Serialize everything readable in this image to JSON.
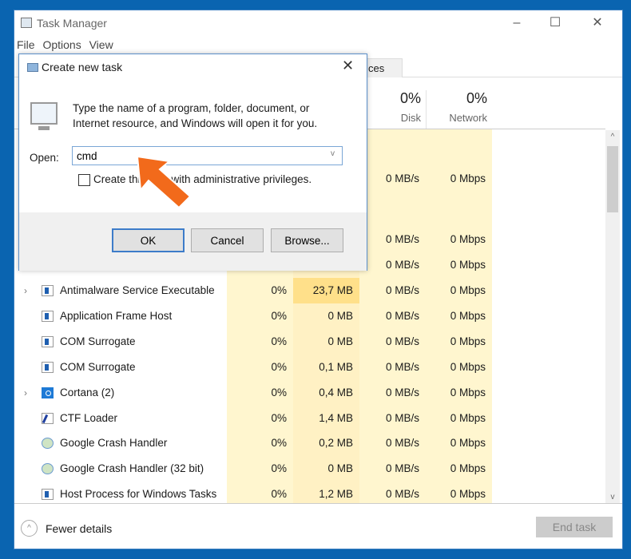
{
  "window": {
    "title": "Task Manager",
    "minimize": "–",
    "maximize": "☐",
    "close": "✕"
  },
  "menu": [
    "File",
    "Options",
    "View"
  ],
  "tab_partial": "ces",
  "headers": {
    "disk_pct": "0%",
    "disk": "Disk",
    "network_pct": "0%",
    "network": "Network"
  },
  "hidden_rows": [
    {
      "disk": "0 MB/s",
      "network": "0 Mbps"
    },
    {
      "disk": "0 MB/s",
      "network": "0 Mbps"
    },
    {
      "disk": "0 MB/s",
      "network": "0 Mbps"
    }
  ],
  "rows": [
    {
      "name": "Antimalware Service Executable",
      "expandable": true,
      "icon": "app",
      "cpu": "0%",
      "memory": "23,7 MB",
      "disk": "0 MB/s",
      "network": "0 Mbps"
    },
    {
      "name": "Application Frame Host",
      "expandable": false,
      "icon": "app",
      "cpu": "0%",
      "memory": "0 MB",
      "disk": "0 MB/s",
      "network": "0 Mbps"
    },
    {
      "name": "COM Surrogate",
      "expandable": false,
      "icon": "app",
      "cpu": "0%",
      "memory": "0 MB",
      "disk": "0 MB/s",
      "network": "0 Mbps"
    },
    {
      "name": "COM Surrogate",
      "expandable": false,
      "icon": "app",
      "cpu": "0%",
      "memory": "0,1 MB",
      "disk": "0 MB/s",
      "network": "0 Mbps"
    },
    {
      "name": "Cortana (2)",
      "expandable": true,
      "icon": "cortana",
      "cpu": "0%",
      "memory": "0,4 MB",
      "disk": "0 MB/s",
      "network": "0 Mbps"
    },
    {
      "name": "CTF Loader",
      "expandable": false,
      "icon": "ctf",
      "cpu": "0%",
      "memory": "1,4 MB",
      "disk": "0 MB/s",
      "network": "0 Mbps"
    },
    {
      "name": "Google Crash Handler",
      "expandable": false,
      "icon": "google",
      "cpu": "0%",
      "memory": "0,2 MB",
      "disk": "0 MB/s",
      "network": "0 Mbps"
    },
    {
      "name": "Google Crash Handler (32 bit)",
      "expandable": false,
      "icon": "google",
      "cpu": "0%",
      "memory": "0 MB",
      "disk": "0 MB/s",
      "network": "0 Mbps"
    },
    {
      "name": "Host Process for Windows Tasks",
      "expandable": false,
      "icon": "app",
      "cpu": "0%",
      "memory": "1,2 MB",
      "disk": "0 MB/s",
      "network": "0 Mbps"
    }
  ],
  "footer": {
    "fewer_details": "Fewer details",
    "end_task": "End task"
  },
  "dialog": {
    "title": "Create new task",
    "prompt_line1": "Type the name of a program, folder, document, or",
    "prompt_line2": "Internet resource, and Windows will open it for you.",
    "open_label": "Open:",
    "open_value": "cmd",
    "admin_label": "Create this task with administrative privileges.",
    "ok": "OK",
    "cancel": "Cancel",
    "browse": "Browse..."
  },
  "colors": {
    "accent": "#0a64b0",
    "arrow": "#f26a1b",
    "highlight": "#ffe08a"
  }
}
